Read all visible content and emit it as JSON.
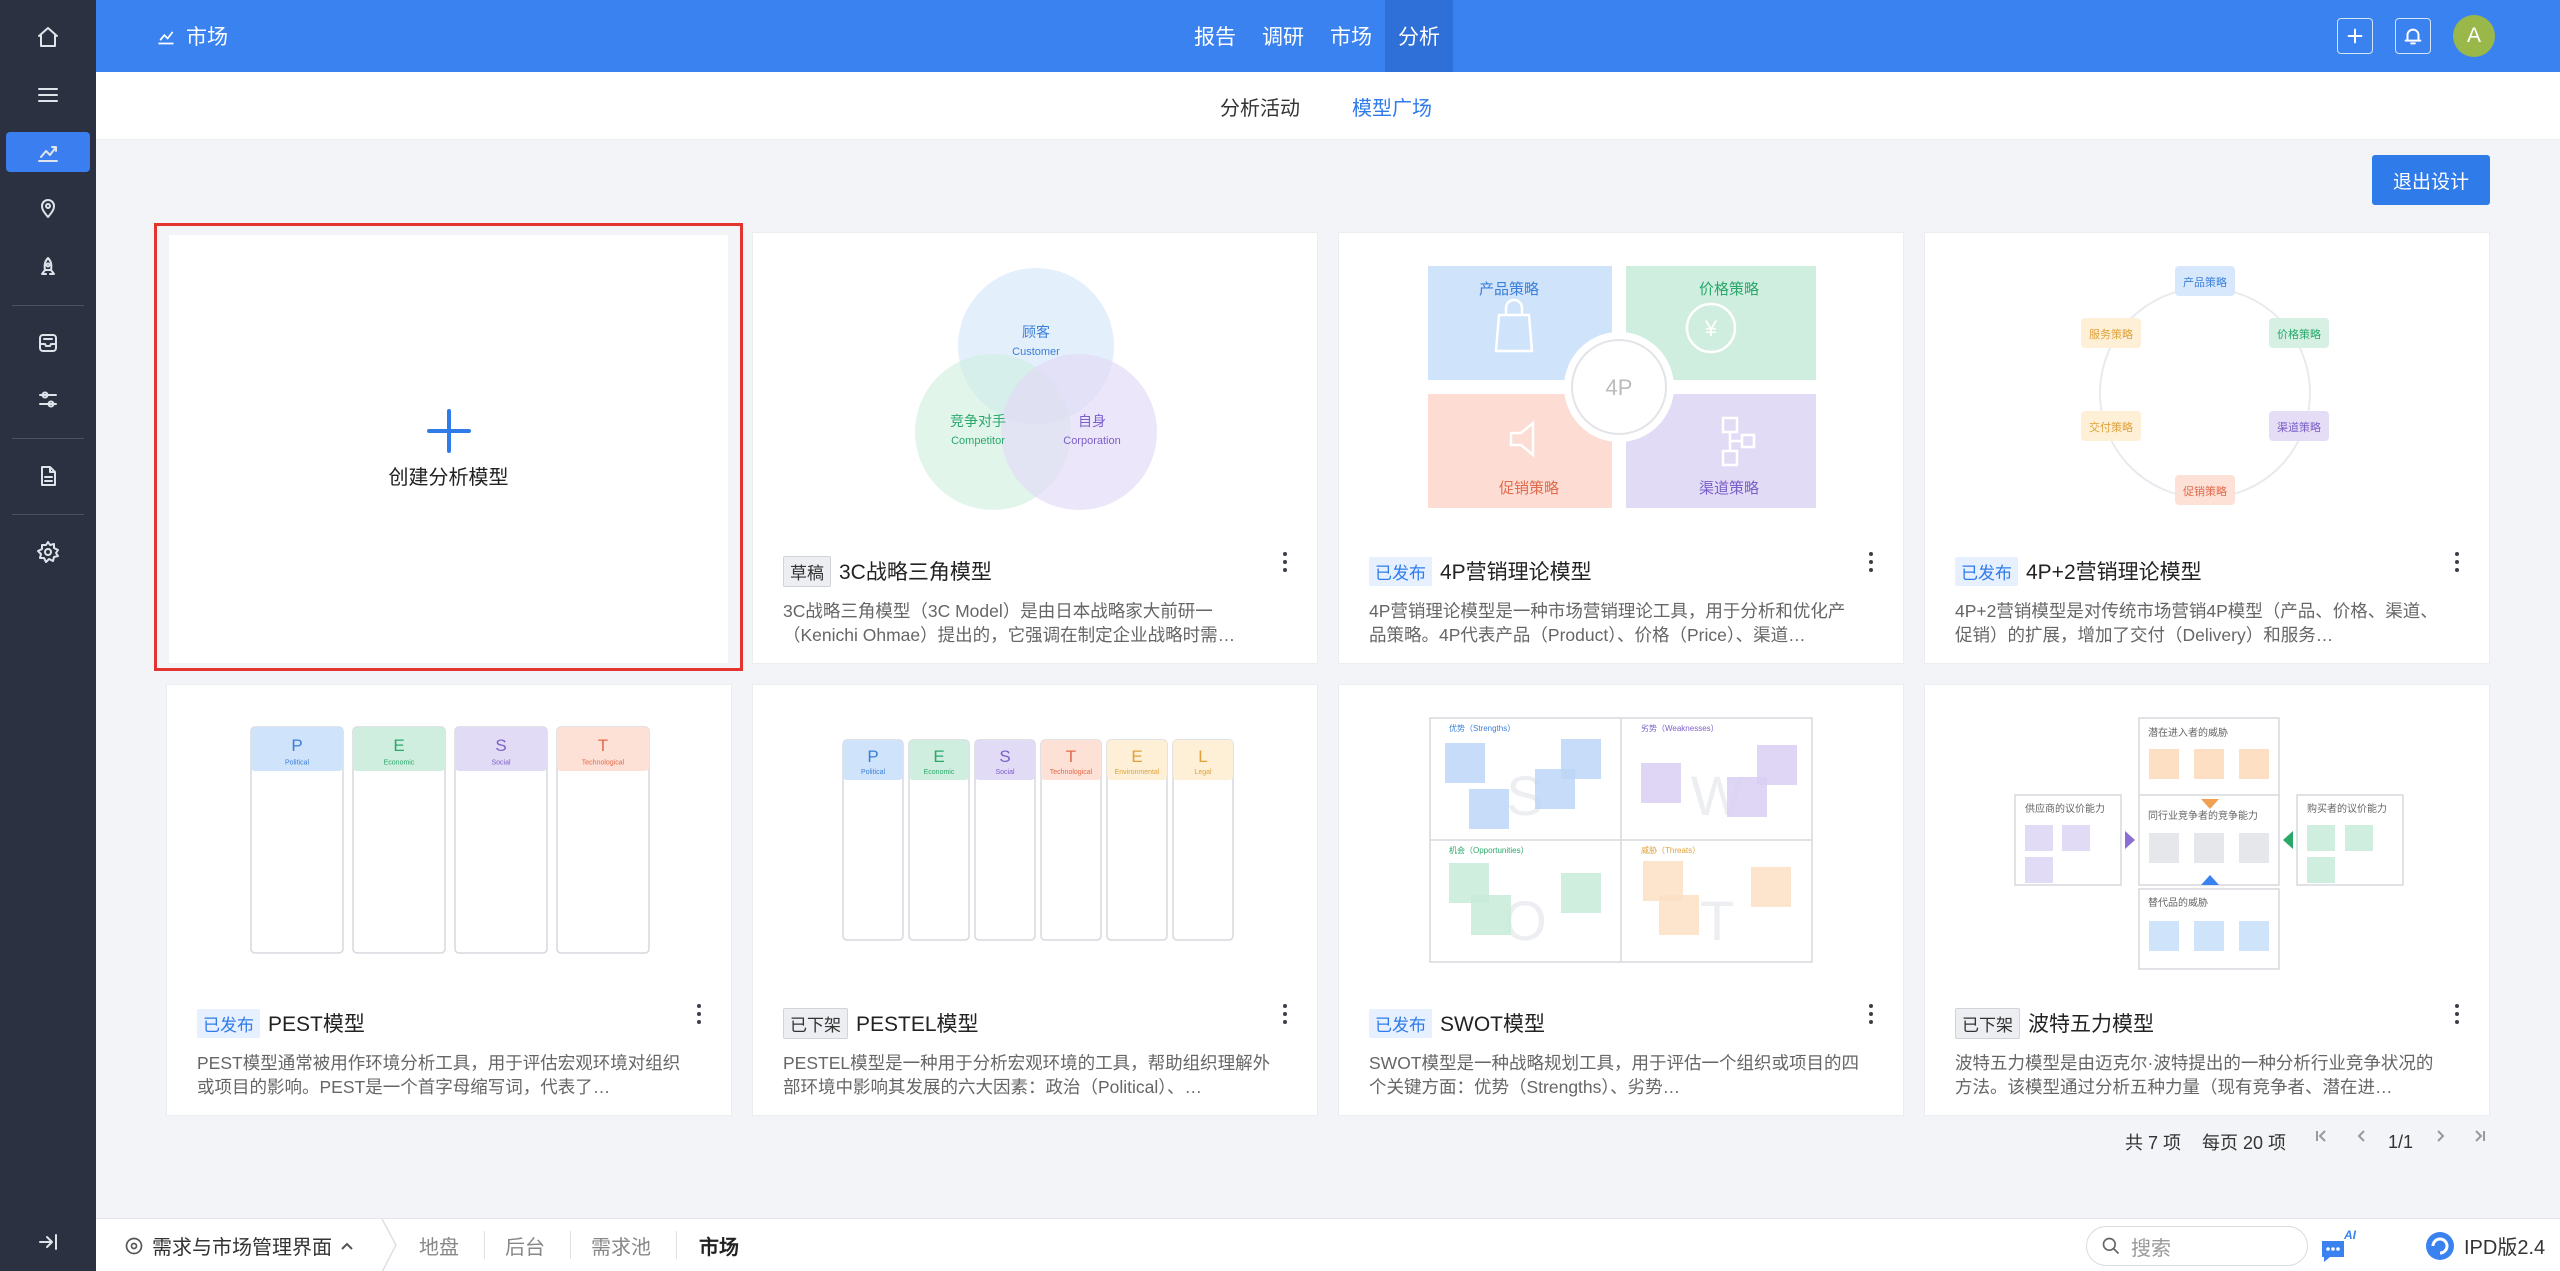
{
  "app": {
    "title": "市场"
  },
  "topnav": [
    "报告",
    "调研",
    "市场",
    "分析"
  ],
  "topnav_active": "分析",
  "user": {
    "avatar_letter": "A"
  },
  "subnav": {
    "tab1": "分析活动",
    "tab2": "模型广场"
  },
  "exit_button": "退出设计",
  "create_card": {
    "label": "创建分析模型"
  },
  "cards": [
    {
      "badge": "草稿",
      "title": "3C战略三角模型",
      "desc": "3C战略三角模型（3C Model）是由日本战略家大前研一（Kenichi Ohmae）提出的，它强调在制定企业战略时需…"
    },
    {
      "badge": "已发布",
      "title": "4P营销理论模型",
      "desc": "4P营销理论模型是一种市场营销理论工具，用于分析和优化产品策略。4P代表产品（Product）、价格（Price）、渠道…"
    },
    {
      "badge": "已发布",
      "title": "4P+2营销理论模型",
      "desc": "4P+2营销模型是对传统市场营销4P模型（产品、价格、渠道、促销）的扩展，增加了交付（Delivery）和服务…"
    },
    {
      "badge": "已发布",
      "title": "PEST模型",
      "desc": "PEST模型通常被用作环境分析工具，用于评估宏观环境对组织或项目的影响。PEST是一个首字母缩写词，代表了…"
    },
    {
      "badge": "已下架",
      "title": "PESTEL模型",
      "desc": "PESTEL模型是一种用于分析宏观环境的工具，帮助组织理解外部环境中影响其发展的六大因素：政治（Political）、…"
    },
    {
      "badge": "已发布",
      "title": "SWOT模型",
      "desc": "SWOT模型是一种战略规划工具，用于评估一个组织或项目的四个关键方面：优势（Strengths）、劣势…"
    },
    {
      "badge": "已下架",
      "title": "波特五力模型",
      "desc": "波特五力模型是由迈克尔·波特提出的一种分析行业竞争状况的方法。该模型通过分析五种力量（现有竞争者、潜在进…"
    }
  ],
  "thumbs": {
    "c3": {
      "customer": "顾客",
      "customer_en": "Customer",
      "competitor": "竞争对手",
      "competitor_en": "Competitor",
      "self": "自身",
      "self_en": "Corporation"
    },
    "p4": {
      "product": "产品策略",
      "price": "价格策略",
      "promo": "促销策略",
      "channel": "渠道策略",
      "center": "4P"
    },
    "p42": {
      "product": "产品策略",
      "price": "价格策略",
      "channel": "渠道策略",
      "promo": "促销策略",
      "delivery": "交付策略",
      "service": "服务策略"
    },
    "pest": [
      {
        "l": "P",
        "s": "Political"
      },
      {
        "l": "E",
        "s": "Economic"
      },
      {
        "l": "S",
        "s": "Social"
      },
      {
        "l": "T",
        "s": "Technological"
      }
    ],
    "pestel": [
      {
        "l": "P",
        "s": "Political"
      },
      {
        "l": "E",
        "s": "Economic"
      },
      {
        "l": "S",
        "s": "Social"
      },
      {
        "l": "T",
        "s": "Technological"
      },
      {
        "l": "E",
        "s": "Environmental"
      },
      {
        "l": "L",
        "s": "Legal"
      }
    ],
    "swot": {
      "s": "优势（Strengths）",
      "w": "劣势（Weaknesses）",
      "o": "机会（Opportunities）",
      "t": "威胁（Threats）"
    },
    "porter": {
      "top": "潜在进入者的威胁",
      "left": "供应商的议价能力",
      "center": "同行业竞争者的竞争能力",
      "right": "购买者的议价能力",
      "bottom": "替代品的威胁"
    }
  },
  "pager": {
    "total": "共 7 项",
    "per_page": "每页 20 项",
    "page": "1/1"
  },
  "bottombar": {
    "workspace": "需求与市场管理界面",
    "items": [
      "地盘",
      "后台",
      "需求池",
      "市场"
    ],
    "search_placeholder": "搜索",
    "ai": "AI",
    "version": "IPD版2.4"
  },
  "colors": {
    "primary": "#3a82f0",
    "rail": "#2b3140",
    "highlight_border": "#e3342f"
  }
}
